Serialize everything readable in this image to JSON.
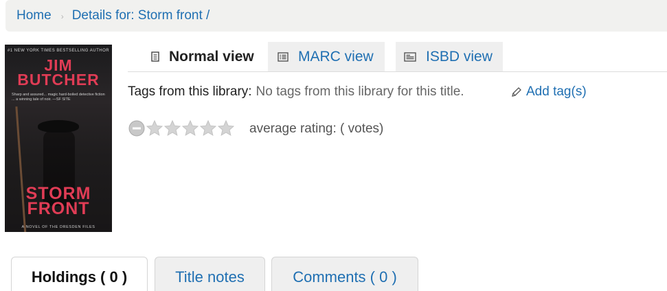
{
  "breadcrumb": {
    "home": "Home",
    "separator": "›",
    "current": "Details for: Storm front /"
  },
  "cover": {
    "top_line": "#1 NEW YORK TIMES BESTSELLING AUTHOR",
    "author_line1": "JIM",
    "author_line2": "BUTCHER",
    "blurb": "Sharp and assured... magic hard-boiled detective fiction ... a winning tale of noir. —SF SITE",
    "title_line1": "STORM",
    "title_line2": "FRONT",
    "subtitle": "A NOVEL OF THE DRESDEN FILES"
  },
  "view_tabs": [
    {
      "label": "Normal view",
      "icon": "document-icon",
      "active": true
    },
    {
      "label": "MARC view",
      "icon": "list-icon",
      "active": false
    },
    {
      "label": "ISBD view",
      "icon": "card-icon",
      "active": false
    }
  ],
  "tags": {
    "label": "Tags from this library:",
    "value": "No tags from this library for this title.",
    "add_label": "Add tag(s)"
  },
  "rating": {
    "stars_total": 5,
    "stars_filled": 0,
    "text": "average rating: ( votes)"
  },
  "bottom_tabs": [
    {
      "label": "Holdings ( 0 )",
      "active": true
    },
    {
      "label": "Title notes",
      "active": false
    },
    {
      "label": "Comments ( 0 )",
      "active": false
    }
  ],
  "colors": {
    "link": "#1f6fb2",
    "breadcrumb_bg": "#f1f1ef",
    "tab_inactive_bg": "#efefef",
    "cover_accent": "#e03c55"
  }
}
